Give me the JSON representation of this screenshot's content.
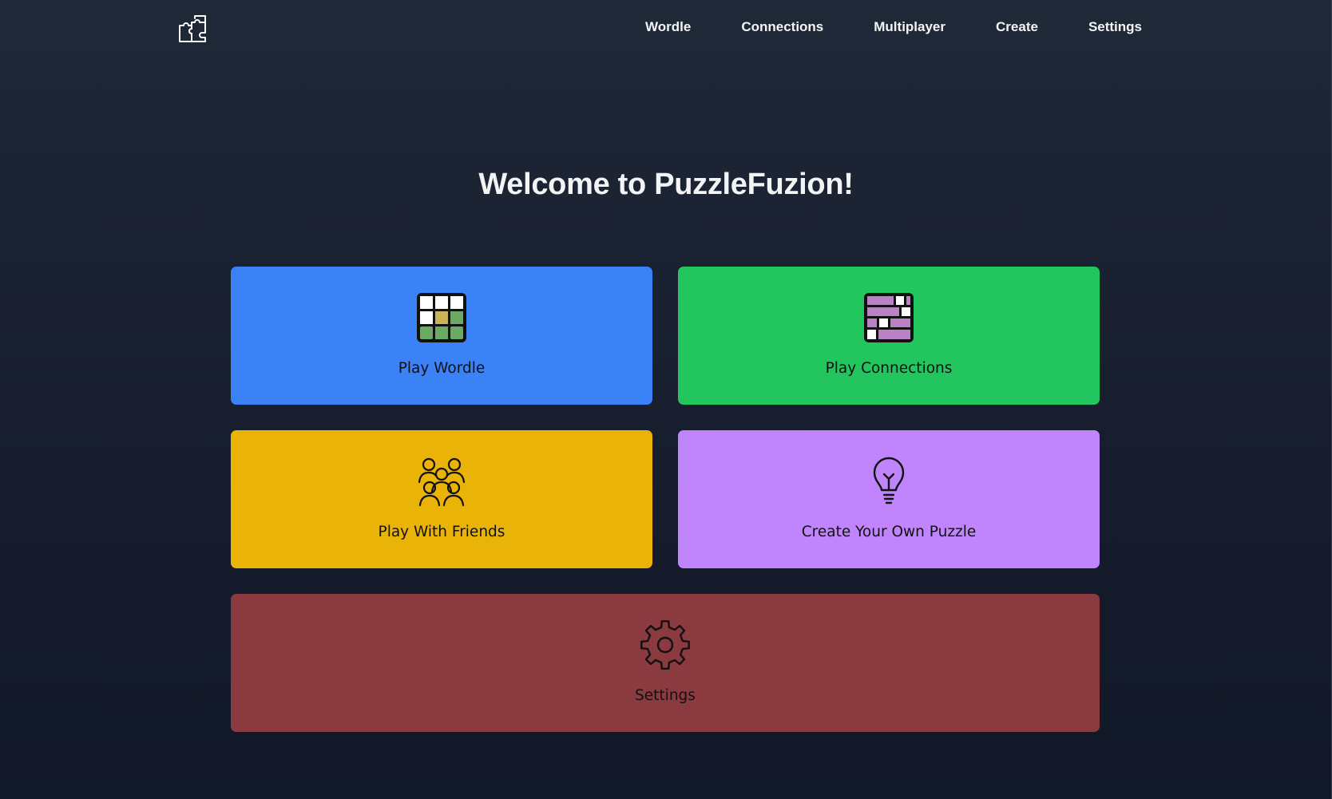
{
  "nav": {
    "logo_icon": "puzzle-piece-icon",
    "links": [
      {
        "label": "Wordle"
      },
      {
        "label": "Connections"
      },
      {
        "label": "Multiplayer"
      },
      {
        "label": "Create"
      },
      {
        "label": "Settings"
      }
    ]
  },
  "main": {
    "title": "Welcome to PuzzleFuzion!",
    "cards": [
      {
        "label": "Play Wordle",
        "icon": "wordle-grid-icon",
        "color": "#3b82f6"
      },
      {
        "label": "Play Connections",
        "icon": "connections-grid-icon",
        "color": "#22c55e"
      },
      {
        "label": "Play With Friends",
        "icon": "people-group-icon",
        "color": "#eab308"
      },
      {
        "label": "Create Your Own Puzzle",
        "icon": "lightbulb-icon",
        "color": "#c084fc"
      },
      {
        "label": "Settings",
        "icon": "gear-icon",
        "color": "#8b3a3f"
      }
    ]
  },
  "colors": {
    "background_top": "#1f2937",
    "background_bottom": "#111827",
    "wordle_green": "#6aaa64",
    "wordle_yellow": "#c9b458",
    "connections_purple": "#ba81c5"
  }
}
